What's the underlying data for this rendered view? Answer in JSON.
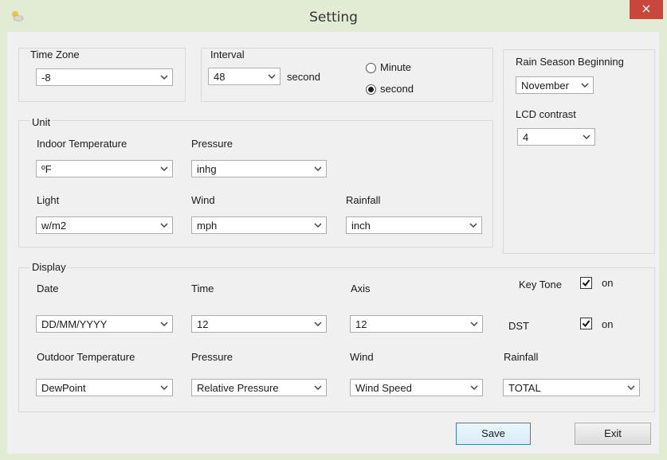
{
  "window": {
    "title": "Setting",
    "close_label": "×",
    "icon": "weather-app-icon"
  },
  "time_zone": {
    "label": "Time Zone",
    "value": "-8"
  },
  "interval": {
    "label": "Interval",
    "value": "48",
    "suffix": "second",
    "options": [
      "Minute",
      "second"
    ],
    "selected": "second"
  },
  "rain_season": {
    "label": "Rain Season Beginning",
    "value": "November"
  },
  "lcd_contrast": {
    "label": "LCD contrast",
    "value": "4"
  },
  "unit": {
    "label": "Unit",
    "indoor_temperature": {
      "label": "Indoor Temperature",
      "value": "ºF"
    },
    "pressure": {
      "label": "Pressure",
      "value": "inhg"
    },
    "light": {
      "label": "Light",
      "value": "w/m2"
    },
    "wind": {
      "label": "Wind",
      "value": "mph"
    },
    "rainfall": {
      "label": "Rainfall",
      "value": "inch"
    }
  },
  "display": {
    "label": "Display",
    "date": {
      "label": "Date",
      "value": "DD/MM/YYYY"
    },
    "time": {
      "label": "Time",
      "value": "12"
    },
    "axis": {
      "label": "Axis",
      "value": "12"
    },
    "key_tone": {
      "label": "Key Tone",
      "checked": true,
      "on_label": "on"
    },
    "dst": {
      "label": "DST",
      "checked": true,
      "on_label": "on"
    },
    "outdoor_temperature": {
      "label": "Outdoor Temperature",
      "value": "DewPoint"
    },
    "pressure": {
      "label": "Pressure",
      "value": "Relative Pressure"
    },
    "wind": {
      "label": "Wind",
      "value": "Wind Speed"
    },
    "rainfall": {
      "label": "Rainfall",
      "value": "TOTAL"
    }
  },
  "buttons": {
    "save": "Save",
    "exit": "Exit"
  }
}
